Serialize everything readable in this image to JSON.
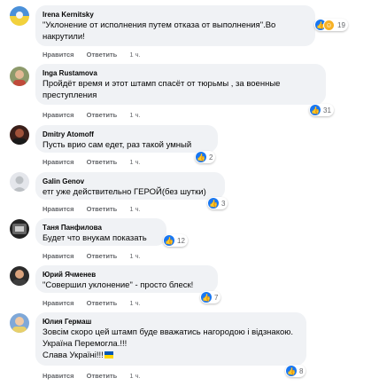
{
  "actions": {
    "like": "Нравится",
    "reply": "Ответить"
  },
  "comments": [
    {
      "author": "Irena Kernitsky",
      "text": "\"Уклонение от исполнения путем отказа от выполнения\".Во\nнакрутили!",
      "time": "1 ч.",
      "reaction_count": "19",
      "reactions": [
        "like-icon",
        "haha-icon"
      ],
      "avatar": "ukraine-flag-avatar"
    },
    {
      "author": "Inga Rustamova",
      "text": "Пройдёт время и этот штамп спасёт от тюрьмы , за военные\nпреступления",
      "time": "1 ч.",
      "reaction_count": "31",
      "reactions": [
        "like-icon"
      ],
      "avatar": "user-photo-avatar"
    },
    {
      "author": "Dmitry Atomoff",
      "text": "Пусть врио сам едет, раз такой умный",
      "time": "1 ч.",
      "reaction_count": "2",
      "reactions": [
        "like-icon"
      ],
      "avatar": "user-photo-avatar"
    },
    {
      "author": "Galin Genov",
      "text": "етг уже действительно ГЕРОЙ(без шутки)",
      "time": "1 ч.",
      "reaction_count": "3",
      "reactions": [
        "like-icon"
      ],
      "avatar": "default-person-avatar"
    },
    {
      "author": "Таня Панфилова",
      "text": "Будет что внукам показать",
      "time": "1 ч.",
      "reaction_count": "12",
      "reactions": [
        "like-icon"
      ],
      "avatar": "user-photo-avatar"
    },
    {
      "author": "Юрий Ячменев",
      "text": "\"Совершил уклонение\" - просто блеск!",
      "time": "1 ч.",
      "reaction_count": "7",
      "reactions": [
        "like-icon"
      ],
      "avatar": "user-photo-avatar"
    },
    {
      "author": "Юлия Гермаш",
      "text": "Зовсім скоро цей штамп буде вважатись нагородою і відзнакою.\nУкраїна Перемогла.!!!\nСлава Україні!!!",
      "time": "1 ч.",
      "reaction_count": "8",
      "reactions": [
        "like-icon"
      ],
      "avatar": "user-photo-avatar",
      "trailing_emoji": "ukraine-flag-emoji"
    }
  ]
}
